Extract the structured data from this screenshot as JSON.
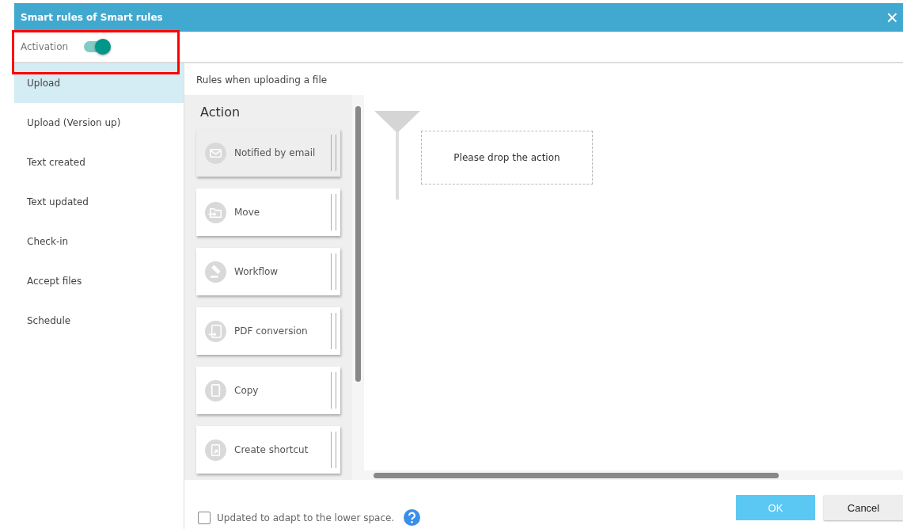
{
  "window": {
    "title": "Smart rules of Smart rules",
    "close": "×"
  },
  "activation": {
    "label": "Activation",
    "on": true
  },
  "sidebar": {
    "items": [
      {
        "label": "Upload",
        "selected": true
      },
      {
        "label": "Upload (Version up)",
        "selected": false
      },
      {
        "label": "Text created",
        "selected": false
      },
      {
        "label": "Text updated",
        "selected": false
      },
      {
        "label": "Check-in",
        "selected": false
      },
      {
        "label": "Accept files",
        "selected": false
      },
      {
        "label": "Schedule",
        "selected": false
      }
    ]
  },
  "rules_heading": "Rules when uploading a file",
  "action_panel": {
    "title": "Action",
    "items": [
      {
        "label": "Notified by email",
        "kind": "email",
        "selected": true
      },
      {
        "label": "Move",
        "kind": "move",
        "selected": false
      },
      {
        "label": "Workflow",
        "kind": "workflow",
        "selected": false
      },
      {
        "label": "PDF conversion",
        "kind": "pdf",
        "selected": false
      },
      {
        "label": "Copy",
        "kind": "copy",
        "selected": false
      },
      {
        "label": "Create shortcut",
        "kind": "shortcut",
        "selected": false
      }
    ]
  },
  "drop_zone": "Please drop the action",
  "footer": {
    "checkbox": {
      "label": "Updated to adapt to the lower space.",
      "checked": false
    },
    "ok": "OK",
    "cancel": "Cancel"
  }
}
